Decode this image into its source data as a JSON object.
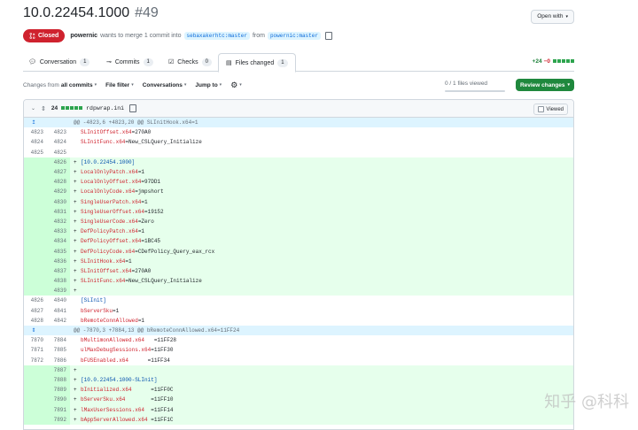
{
  "pr": {
    "title": "10.0.22454.1000",
    "number": "#49",
    "status": "Closed",
    "author": "powernic",
    "action_text": "wants to merge 1 commit into",
    "base_branch": "sebaxakerhtc:master",
    "from_text": "from",
    "head_branch": "powernic:master"
  },
  "open_with": "Open with",
  "tabs": [
    {
      "label": "Conversation",
      "count": "1"
    },
    {
      "label": "Commits",
      "count": "1"
    },
    {
      "label": "Checks",
      "count": "0"
    },
    {
      "label": "Files changed",
      "count": "1"
    }
  ],
  "diffstat": {
    "added": "+24",
    "removed": "−0"
  },
  "toolbar": {
    "changes_from_prefix": "Changes from",
    "changes_from_value": "all commits",
    "file_filter": "File filter",
    "conversations": "Conversations",
    "jump_to": "Jump to"
  },
  "viewed_count": "0 / 1 files viewed",
  "viewed_fraction": 0,
  "review_button": "Review changes",
  "file": {
    "count": "24",
    "name": "rdpwrap.ini",
    "viewed_label": "Viewed"
  },
  "diff_rows": [
    {
      "type": "hunk",
      "old": "",
      "new": "",
      "text": "@@ -4823,6 +4823,20 @@ SLInitHook.x64=1"
    },
    {
      "type": "ctx",
      "old": "4823",
      "new": "4823",
      "key": "SLInitOffset.x64",
      "val": "=270A0"
    },
    {
      "type": "ctx",
      "old": "4824",
      "new": "4824",
      "key": "SLInitFunc.x64",
      "val": "=New_CSLQuery_Initialize"
    },
    {
      "type": "ctx",
      "old": "4825",
      "new": "4825",
      "key": "",
      "val": ""
    },
    {
      "type": "add",
      "old": "",
      "new": "4826",
      "key": "",
      "val": "[10.0.22454.1000]",
      "section": true
    },
    {
      "type": "add",
      "old": "",
      "new": "4827",
      "key": "LocalOnlyPatch.x64",
      "val": "=1"
    },
    {
      "type": "add",
      "old": "",
      "new": "4828",
      "key": "LocalOnlyOffset.x64",
      "val": "=97DD1"
    },
    {
      "type": "add",
      "old": "",
      "new": "4829",
      "key": "LocalOnlyCode.x64",
      "val": "=jmpshort"
    },
    {
      "type": "add",
      "old": "",
      "new": "4830",
      "key": "SingleUserPatch.x64",
      "val": "=1"
    },
    {
      "type": "add",
      "old": "",
      "new": "4831",
      "key": "SingleUserOffset.x64",
      "val": "=19152"
    },
    {
      "type": "add",
      "old": "",
      "new": "4832",
      "key": "SingleUserCode.x64",
      "val": "=Zero"
    },
    {
      "type": "add",
      "old": "",
      "new": "4833",
      "key": "DefPolicyPatch.x64",
      "val": "=1"
    },
    {
      "type": "add",
      "old": "",
      "new": "4834",
      "key": "DefPolicyOffset.x64",
      "val": "=1BC45"
    },
    {
      "type": "add",
      "old": "",
      "new": "4835",
      "key": "DefPolicyCode.x64",
      "val": "=CDefPolicy_Query_eax_rcx"
    },
    {
      "type": "add",
      "old": "",
      "new": "4836",
      "key": "SLInitHook.x64",
      "val": "=1"
    },
    {
      "type": "add",
      "old": "",
      "new": "4837",
      "key": "SLInitOffset.x64",
      "val": "=270A0"
    },
    {
      "type": "add",
      "old": "",
      "new": "4838",
      "key": "SLInitFunc.x64",
      "val": "=New_CSLQuery_Initialize"
    },
    {
      "type": "add",
      "old": "",
      "new": "4839",
      "key": "",
      "val": ""
    },
    {
      "type": "ctx",
      "old": "4826",
      "new": "4840",
      "key": "",
      "val": "[SLInit]",
      "section": true
    },
    {
      "type": "ctx",
      "old": "4827",
      "new": "4841",
      "key": "bServerSku",
      "val": "=1"
    },
    {
      "type": "ctx",
      "old": "4828",
      "new": "4842",
      "key": "bRemoteConnAllowed",
      "val": "=1"
    },
    {
      "type": "hunk",
      "old": "",
      "new": "",
      "text": "@@ -7870,3 +7884,13 @@ bRemoteConnAllowed.x64=11FF24"
    },
    {
      "type": "ctx",
      "old": "7870",
      "new": "7884",
      "key": "bMultimonAllowed.x64",
      "val": "   =11FF28"
    },
    {
      "type": "ctx",
      "old": "7871",
      "new": "7885",
      "key": "ulMaxDebugSessions.x64",
      "val": "=11FF30"
    },
    {
      "type": "ctx",
      "old": "7872",
      "new": "7886",
      "key": "bFUSEnabled.x64",
      "val": "      =11FF34"
    },
    {
      "type": "add",
      "old": "",
      "new": "7887",
      "key": "",
      "val": ""
    },
    {
      "type": "add",
      "old": "",
      "new": "7888",
      "key": "",
      "val": "[10.0.22454.1000-SLInit]",
      "section": true
    },
    {
      "type": "add",
      "old": "",
      "new": "7889",
      "key": "bInitialized.x64",
      "val": "      =11FF0C"
    },
    {
      "type": "add",
      "old": "",
      "new": "7890",
      "key": "bServerSku.x64",
      "val": "        =11FF10"
    },
    {
      "type": "add",
      "old": "",
      "new": "7891",
      "key": "lMaxUserSessions.x64",
      "val": "  =11FF14"
    },
    {
      "type": "add",
      "old": "",
      "new": "7892",
      "key": "bAppServerAllowed.x64",
      "val": " =11FF1C"
    }
  ],
  "watermark": "知乎 @科科"
}
